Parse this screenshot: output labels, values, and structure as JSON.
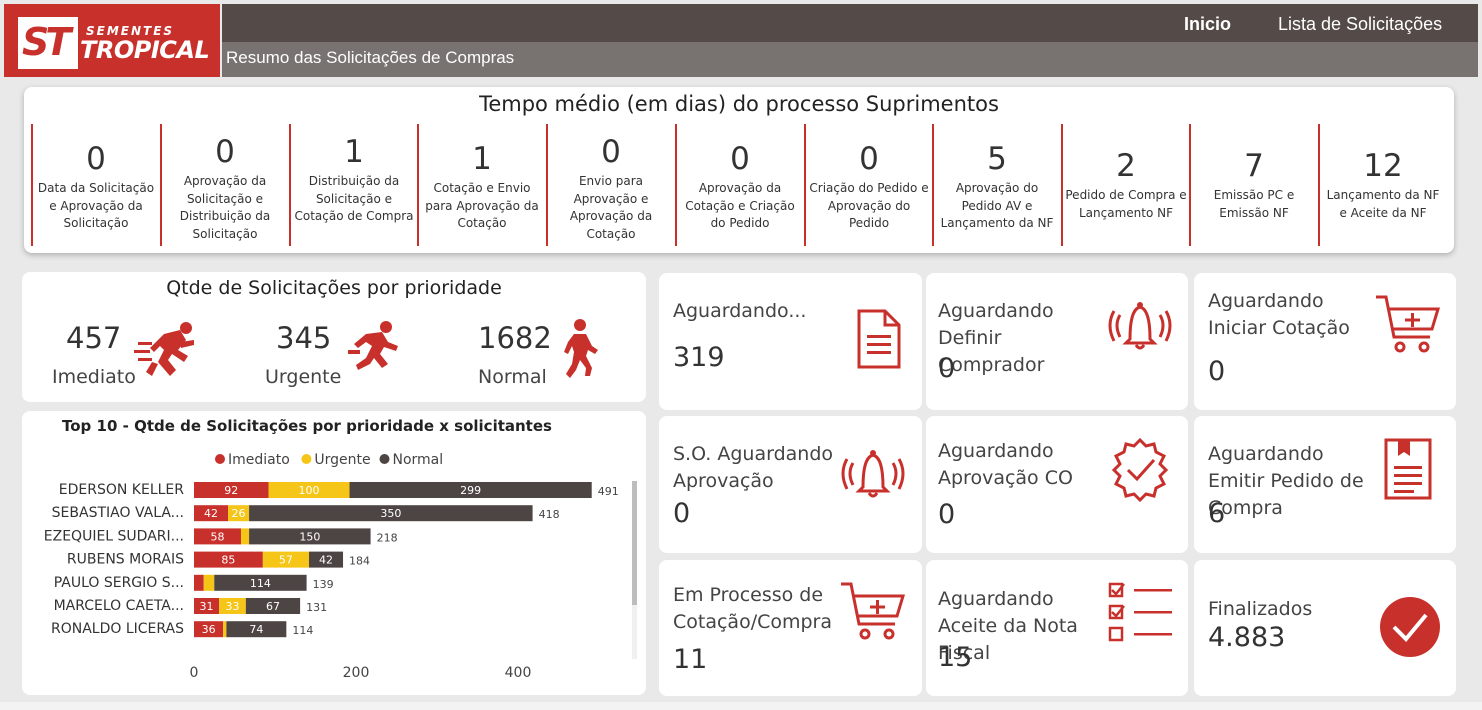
{
  "brand": {
    "logo_mark": "ST",
    "line1": "SEMENTES",
    "line2": "TROPICAL"
  },
  "header": {
    "subtitle": "Resumo das Solicitações de Compras",
    "nav": {
      "inicio": "Inicio",
      "lista": "Lista de Solicitações"
    }
  },
  "tempo": {
    "title": "Tempo médio (em dias) do processo Suprimentos",
    "steps": [
      {
        "value": "0",
        "label": "Data da Solicitação e Aprovação da Solicitação"
      },
      {
        "value": "0",
        "label": "Aprovação da Solicitação e Distribuição da Solicitação"
      },
      {
        "value": "1",
        "label": "Distribuição da Solicitação e Cotação de Compra"
      },
      {
        "value": "1",
        "label": "Cotação e Envio para Aprovação da Cotação"
      },
      {
        "value": "0",
        "label": "Envio para Aprovação e Aprovação da Cotação"
      },
      {
        "value": "0",
        "label": "Aprovação da Cotação e Criação do Pedido"
      },
      {
        "value": "0",
        "label": "Criação do Pedido e Aprovação do Pedido"
      },
      {
        "value": "5",
        "label": "Aprovação do Pedido AV e Lançamento da NF"
      },
      {
        "value": "2",
        "label": "Pedido de Compra e Lançamento NF"
      },
      {
        "value": "7",
        "label": "Emissão PC e Emissão NF"
      },
      {
        "value": "12",
        "label": "Lançamento da NF e Aceite da NF"
      }
    ]
  },
  "prioridade": {
    "title": "Qtde de Solicitações por prioridade",
    "items": [
      {
        "value": "457",
        "label": "Imediato"
      },
      {
        "value": "345",
        "label": "Urgente"
      },
      {
        "value": "1682",
        "label": "Normal"
      }
    ]
  },
  "chart_data": {
    "type": "bar",
    "orientation": "horizontal",
    "stacked": true,
    "title": "Top 10 - Qtde de Solicitações por prioridade x solicitantes",
    "legend_position": "top",
    "categories": [
      "EDERSON KELLER",
      "SEBASTIAO VALA...",
      "EZEQUIEL SUDARI...",
      "RUBENS MORAIS",
      "PAULO SERGIO S...",
      "MARCELO CAETA...",
      "RONALDO LICERAS"
    ],
    "series": [
      {
        "name": "Imediato",
        "color": "#c8302c",
        "values": [
          92,
          42,
          58,
          85,
          12,
          31,
          36
        ]
      },
      {
        "name": "Urgente",
        "color": "#f5c518",
        "values": [
          100,
          26,
          10,
          57,
          13,
          33,
          4
        ]
      },
      {
        "name": "Normal",
        "color": "#4d4543",
        "values": [
          299,
          350,
          150,
          42,
          114,
          67,
          74
        ]
      }
    ],
    "totals": [
      491,
      418,
      218,
      184,
      139,
      131,
      114
    ],
    "xticks": [
      "0",
      "200",
      "400"
    ],
    "xlim": [
      0,
      560
    ],
    "grid": false
  },
  "stats": [
    {
      "label": "Aguardando...",
      "value": "319",
      "icon": "document-icon"
    },
    {
      "label": "Aguardando Definir Comprador",
      "value": "0",
      "icon": "bell-ringing-icon"
    },
    {
      "label": "Aguardando Iniciar Cotação",
      "value": "0",
      "icon": "cart-add-icon"
    },
    {
      "label": "S.O. Aguardando Aprovação",
      "value": "0",
      "icon": "bell-ringing-icon"
    },
    {
      "label": "Aguardando Aprovação CO",
      "value": "0",
      "icon": "check-badge-icon"
    },
    {
      "label": "Aguardando Emitir Pedido de Compra",
      "value": "6",
      "icon": "order-document-icon"
    },
    {
      "label": "Em Processo de Cotação/Compra",
      "value": "11",
      "icon": "cart-add-icon"
    },
    {
      "label": "Aguardando Aceite da Nota Fiscal",
      "value": "15",
      "icon": "checklist-icon"
    },
    {
      "label": "Finalizados",
      "value": "4.883",
      "icon": "check-circle-icon"
    }
  ],
  "colors": {
    "accent": "#c8302c",
    "dark": "#544a47",
    "gray": "#787270",
    "yellow": "#f5c518"
  }
}
